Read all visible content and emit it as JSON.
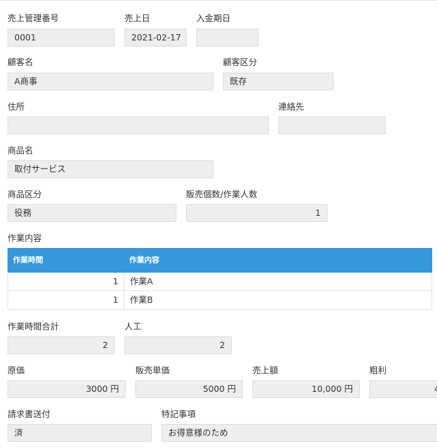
{
  "sales_no": {
    "label": "売上管理番号",
    "value": "0001"
  },
  "sales_date": {
    "label": "売上日",
    "value": "2021-02-17"
  },
  "payment_date": {
    "label": "入金期日",
    "value": ""
  },
  "customer_name": {
    "label": "顧客名",
    "value": "A商事"
  },
  "customer_class": {
    "label": "顧客区分",
    "value": "既存"
  },
  "address": {
    "label": "住所",
    "value": ""
  },
  "contact": {
    "label": "連絡先",
    "value": ""
  },
  "product_name": {
    "label": "商品名",
    "value": "取付サービス"
  },
  "product_class": {
    "label": "商品区分",
    "value": "役務"
  },
  "sales_qty": {
    "label": "販売個数/作業人数",
    "value": "1"
  },
  "work": {
    "label": "作業内容",
    "headers": [
      "作業時間",
      "作業内容"
    ],
    "rows": [
      {
        "hours": "1",
        "content": "作業A"
      },
      {
        "hours": "1",
        "content": "作業B"
      }
    ]
  },
  "total_hours": {
    "label": "作業時間合計",
    "value": "2"
  },
  "manpower": {
    "label": "人工",
    "value": "2"
  },
  "cost": {
    "label": "原価",
    "value": "3000 円"
  },
  "unit_price": {
    "label": "販売単価",
    "value": "5000 円"
  },
  "sales_amount": {
    "label": "売上額",
    "value": "10,000 円"
  },
  "gross_profit": {
    "label": "粗利",
    "value": "4"
  },
  "invoice_sent": {
    "label": "請求書送付",
    "value": "済"
  },
  "remarks": {
    "label": "特記事項",
    "value": "お得意様のため"
  },
  "colors": {
    "table_header": "#3498db",
    "field_bg": "#eeeeee",
    "field_border": "#dcdcdc"
  }
}
